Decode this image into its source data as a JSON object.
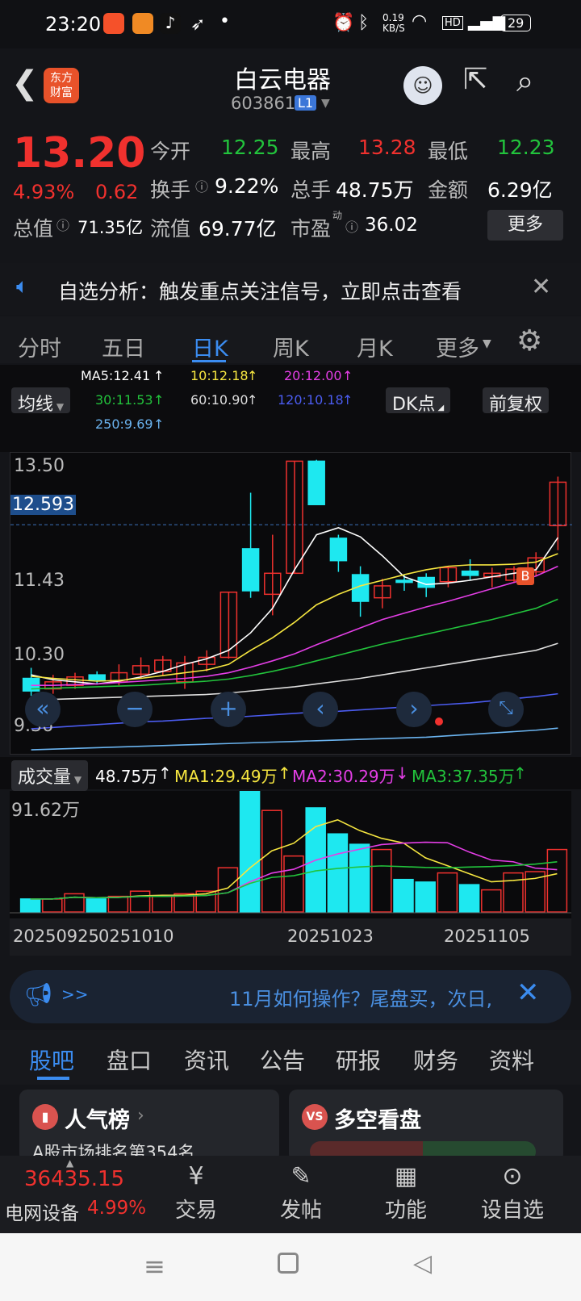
{
  "status": {
    "time": "23:20",
    "net_speed": "0.19\nKB/S",
    "battery": "29"
  },
  "header": {
    "logo": "东方\n财富",
    "stock_name": "白云电器",
    "code": "603861",
    "level": "L1"
  },
  "quote": {
    "price": "13.20",
    "pct": "4.93%",
    "change": "0.62",
    "open_label": "今开",
    "open": "12.25",
    "high_label": "最高",
    "high": "13.28",
    "low_label": "最低",
    "low": "12.23",
    "turnover_label": "换手",
    "turnover": "9.22%",
    "volume_label": "总手",
    "volume": "48.75万",
    "amount_label": "金额",
    "amount": "6.29亿",
    "mcap_label": "总值",
    "mcap": "71.35亿",
    "float_label": "流值",
    "float": "69.77亿",
    "pe_label": "市盈",
    "pe_sup": "动",
    "pe": "36.02",
    "more": "更多"
  },
  "notice": {
    "text": "自选分析：触发重点关注信号，立即点击查看"
  },
  "tabs": [
    "分时",
    "五日",
    "日K",
    "周K",
    "月K",
    "更多"
  ],
  "active_tab": "日K",
  "ma": {
    "ma5": "MA5:12.41",
    "ma10": "10:12.18",
    "ma20": "20:12.00",
    "ma30": "30:11.53",
    "ma60": "60:10.90",
    "ma120": "120:10.18",
    "ma250": "250:9.69",
    "selector": "均线",
    "dk": "DK点",
    "fq": "前复权"
  },
  "chart_data": {
    "type": "candlestick",
    "price_labels": [
      "13.50",
      "12.593",
      "11.43",
      "10.30",
      "9.36"
    ],
    "current_line": "12.593",
    "marker": "B",
    "candles": [
      {
        "o": 10.4,
        "c": 10.22,
        "h": 10.55,
        "l": 10.15
      },
      {
        "o": 10.25,
        "c": 10.35,
        "h": 10.45,
        "l": 10.18
      },
      {
        "o": 10.3,
        "c": 10.42,
        "h": 10.48,
        "l": 10.25
      },
      {
        "o": 10.45,
        "c": 10.38,
        "h": 10.5,
        "l": 10.32
      },
      {
        "o": 10.35,
        "c": 10.48,
        "h": 10.6,
        "l": 10.3
      },
      {
        "o": 10.46,
        "c": 10.58,
        "h": 10.7,
        "l": 10.4
      },
      {
        "o": 10.5,
        "c": 10.66,
        "h": 10.72,
        "l": 10.44
      },
      {
        "o": 10.35,
        "c": 10.62,
        "h": 10.72,
        "l": 10.25
      },
      {
        "o": 10.6,
        "c": 10.7,
        "h": 10.8,
        "l": 10.5
      },
      {
        "o": 10.7,
        "c": 11.63,
        "h": 11.63,
        "l": 10.68
      },
      {
        "o": 12.25,
        "c": 11.65,
        "h": 13.05,
        "l": 11.55
      },
      {
        "o": 11.6,
        "c": 11.9,
        "h": 12.45,
        "l": 11.3
      },
      {
        "o": 11.9,
        "c": 13.5,
        "h": 13.5,
        "l": 11.9
      },
      {
        "o": 13.5,
        "c": 12.88,
        "h": 13.52,
        "l": 12.88
      },
      {
        "o": 12.4,
        "c": 12.08,
        "h": 12.45,
        "l": 11.92
      },
      {
        "o": 11.88,
        "c": 11.5,
        "h": 12.0,
        "l": 11.28
      },
      {
        "o": 11.55,
        "c": 11.72,
        "h": 11.82,
        "l": 11.4
      },
      {
        "o": 11.8,
        "c": 11.77,
        "h": 11.88,
        "l": 11.65
      },
      {
        "o": 11.84,
        "c": 11.7,
        "h": 11.9,
        "l": 11.56
      },
      {
        "o": 11.78,
        "c": 11.98,
        "h": 12.0,
        "l": 11.7
      },
      {
        "o": 11.93,
        "c": 11.87,
        "h": 12.1,
        "l": 11.8
      },
      {
        "o": 11.85,
        "c": 11.9,
        "h": 11.98,
        "l": 11.7
      },
      {
        "o": 11.8,
        "c": 11.96,
        "h": 12.0,
        "l": 11.76
      },
      {
        "o": 11.92,
        "c": 12.12,
        "h": 12.2,
        "l": 11.86
      },
      {
        "o": 12.58,
        "c": 13.2,
        "h": 13.28,
        "l": 12.23
      }
    ],
    "ma_values": {
      "ma5": [
        10.45,
        10.38,
        10.35,
        10.32,
        10.36,
        10.42,
        10.5,
        10.6,
        10.68,
        10.8,
        11.05,
        11.4,
        11.95,
        12.45,
        12.55,
        12.42,
        12.15,
        11.85,
        11.74,
        11.76,
        11.8,
        11.85,
        11.9,
        11.95,
        12.41
      ],
      "ma10": [
        10.43,
        10.4,
        10.38,
        10.36,
        10.37,
        10.4,
        10.44,
        10.48,
        10.52,
        10.6,
        10.8,
        10.98,
        11.2,
        11.45,
        11.6,
        11.72,
        11.8,
        11.88,
        11.95,
        12.0,
        12.02,
        12.02,
        12.03,
        12.06,
        12.18
      ],
      "ma20": [
        10.3,
        10.3,
        10.31,
        10.32,
        10.34,
        10.36,
        10.38,
        10.4,
        10.43,
        10.48,
        10.56,
        10.65,
        10.75,
        10.88,
        11.0,
        11.12,
        11.24,
        11.33,
        11.42,
        11.5,
        11.59,
        11.68,
        11.77,
        11.86,
        12.0
      ],
      "ma30": [
        10.25,
        10.26,
        10.27,
        10.28,
        10.29,
        10.3,
        10.32,
        10.34,
        10.36,
        10.39,
        10.44,
        10.5,
        10.57,
        10.65,
        10.73,
        10.81,
        10.89,
        10.96,
        11.03,
        11.1,
        11.17,
        11.24,
        11.32,
        11.4,
        11.53
      ],
      "ma60": [
        10.1,
        10.1,
        10.11,
        10.12,
        10.13,
        10.14,
        10.15,
        10.16,
        10.17,
        10.19,
        10.22,
        10.25,
        10.28,
        10.32,
        10.36,
        10.4,
        10.45,
        10.5,
        10.55,
        10.6,
        10.65,
        10.7,
        10.75,
        10.8,
        10.9
      ],
      "ma120": [
        9.68,
        9.7,
        9.72,
        9.74,
        9.76,
        9.78,
        9.79,
        9.81,
        9.83,
        9.84,
        9.86,
        9.88,
        9.9,
        9.92,
        9.93,
        9.95,
        9.97,
        9.99,
        10.01,
        10.03,
        10.05,
        10.08,
        10.11,
        10.14,
        10.18
      ],
      "ma250": [
        9.38,
        9.39,
        9.4,
        9.41,
        9.42,
        9.43,
        9.44,
        9.45,
        9.46,
        9.47,
        9.48,
        9.49,
        9.5,
        9.51,
        9.52,
        9.53,
        9.54,
        9.55,
        9.56,
        9.58,
        9.6,
        9.62,
        9.64,
        9.66,
        9.69
      ]
    },
    "volume": {
      "label": "成交量",
      "total": "48.75万",
      "ma1": "MA1:29.49万",
      "ma2": "MA2:30.29万",
      "ma3": "MA3:37.35万",
      "max": "91.62万",
      "bars": [
        10,
        10,
        14,
        10,
        12,
        16,
        12,
        14,
        16,
        34,
        93,
        78,
        43,
        80,
        60,
        52,
        48,
        25,
        23,
        30,
        21,
        17,
        30,
        31,
        48
      ]
    },
    "dates": [
      "20250925",
      "0251010",
      "20251023",
      "20251105"
    ]
  },
  "banner": {
    "arrows": ">>",
    "text": "11月如何操作？尾盘买，次日,"
  },
  "ftabs": [
    "股吧",
    "盘口",
    "资讯",
    "公告",
    "研报",
    "财务",
    "资料"
  ],
  "cards": {
    "left_title": "人气榜",
    "left_sub": "A股市场排名第354名",
    "right_title": "多空看盘"
  },
  "bottom": {
    "index": "36435.15",
    "sector": "电网设备",
    "sector_pct": "4.99%",
    "items": [
      "交易",
      "发帖",
      "功能",
      "设自选"
    ]
  }
}
